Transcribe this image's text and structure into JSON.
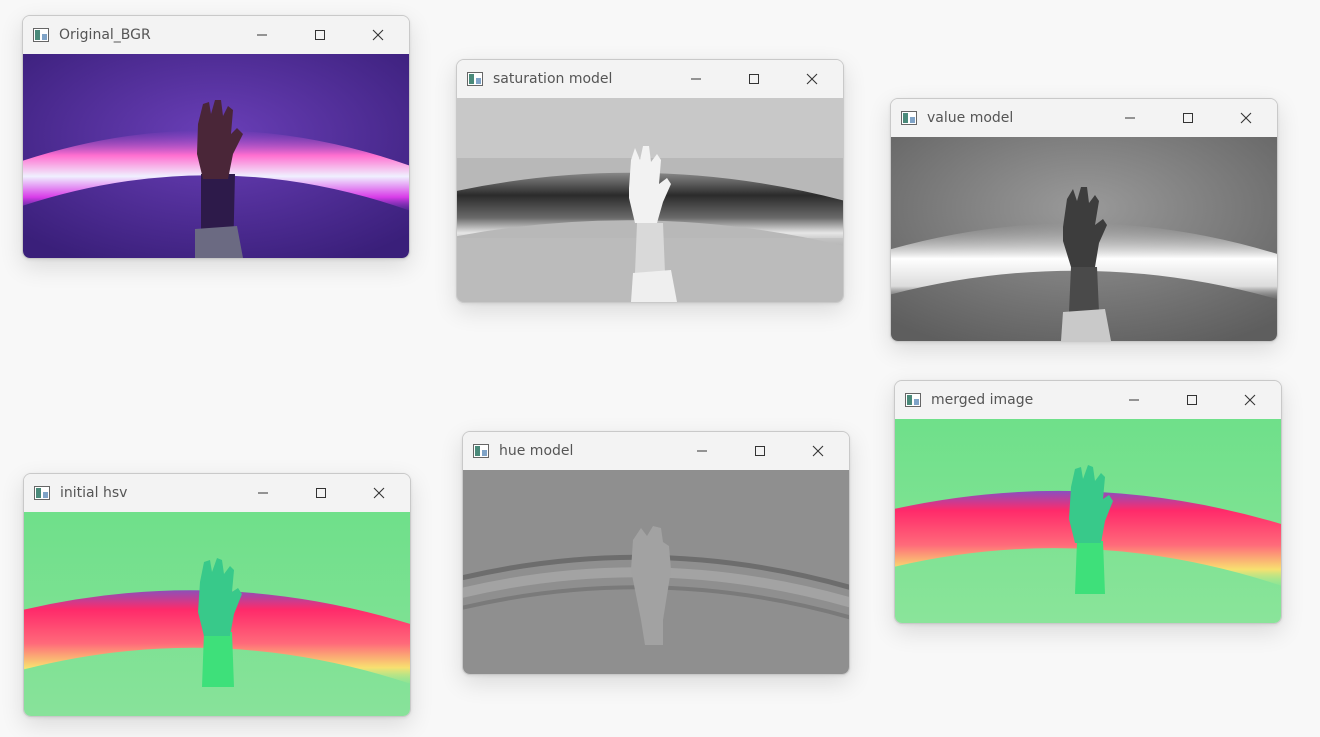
{
  "windows": {
    "original": {
      "title": "Original_BGR"
    },
    "saturation": {
      "title": "saturation model"
    },
    "value": {
      "title": "value model"
    },
    "initial": {
      "title": "initial hsv"
    },
    "hue": {
      "title": "hue model"
    },
    "merged": {
      "title": "merged image"
    }
  },
  "icons": {
    "app": "opencv-window-icon",
    "minimize": "minimize-icon",
    "maximize": "maximize-icon",
    "close": "close-icon"
  },
  "colors": {
    "title_text": "#555555",
    "titlebar": "#f3f3f3",
    "desktop": "#f8f8f8"
  }
}
